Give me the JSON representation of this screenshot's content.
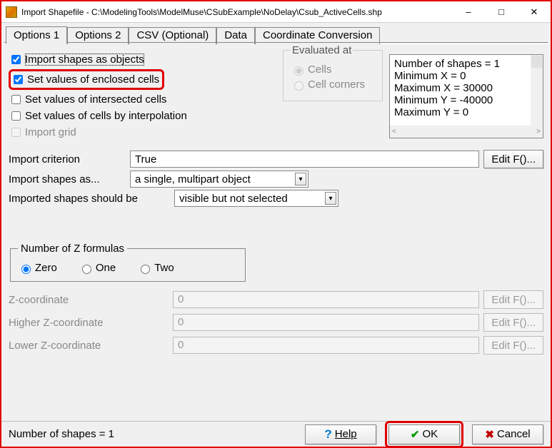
{
  "window": {
    "title": "Import Shapefile - C:\\ModelingTools\\ModelMuse\\CSubExample\\NoDelay\\Csub_ActiveCells.shp"
  },
  "tabs": [
    "Options 1",
    "Options 2",
    "CSV (Optional)",
    "Data",
    "Coordinate Conversion"
  ],
  "checkboxes": {
    "import_shapes": "Import shapes as objects",
    "set_enclosed": "Set values of enclosed cells",
    "set_intersected": "Set values of intersected cells",
    "set_interp": "Set values of cells by interpolation",
    "import_grid": "Import grid"
  },
  "eval": {
    "legend": "Evaluated at",
    "cells": "Cells",
    "corners": "Cell corners"
  },
  "info": {
    "lines": [
      "Number of shapes = 1",
      "Minimum X = 0",
      "Maximum X = 30000",
      "Minimum Y = -40000",
      "Maximum Y = 0"
    ]
  },
  "criterion": {
    "label": "Import criterion",
    "value": "True",
    "editf": "Edit F()..."
  },
  "import_as": {
    "label": "Import shapes as...",
    "value": "a single, multipart object"
  },
  "shapes_should": {
    "label": "Imported shapes should be",
    "value": "visible but not selected"
  },
  "zform": {
    "legend": "Number of Z formulas",
    "zero": "Zero",
    "one": "One",
    "two": "Two"
  },
  "coords": {
    "z": "Z-coordinate",
    "hz": "Higher Z-coordinate",
    "lz": "Lower Z-coordinate",
    "val": "0",
    "editf": "Edit F()..."
  },
  "footer": {
    "status": "Number of shapes = 1",
    "help": "Help",
    "ok": "OK",
    "cancel": "Cancel"
  }
}
